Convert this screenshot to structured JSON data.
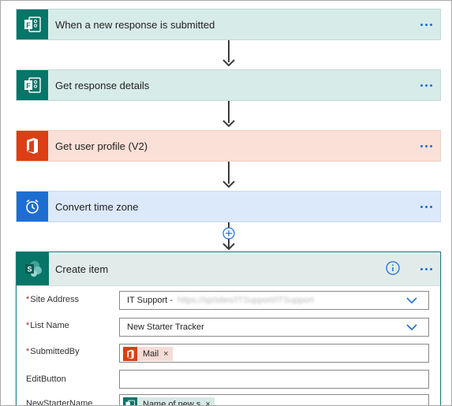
{
  "flow": {
    "steps": [
      {
        "title": "When a new response is submitted",
        "icon": "forms-icon"
      },
      {
        "title": "Get response details",
        "icon": "forms-icon"
      },
      {
        "title": "Get user profile (V2)",
        "icon": "office-icon"
      },
      {
        "title": "Convert time zone",
        "icon": "alarm-clock-icon"
      }
    ]
  },
  "create_item": {
    "title": "Create item",
    "icon": "sharepoint-icon",
    "fields": [
      {
        "label": "Site Address",
        "required": true,
        "value": "IT Support -",
        "value_redacted": "https://sp/sites/ITSupport/ITSupport",
        "type": "dropdown"
      },
      {
        "label": "List Name",
        "required": true,
        "value": "New Starter Tracker",
        "type": "dropdown"
      },
      {
        "label": "SubmittedBy",
        "required": true,
        "token": "Mail",
        "token_icon": "office-icon",
        "type": "token"
      },
      {
        "label": "EditButton",
        "required": false,
        "value": "",
        "type": "text"
      },
      {
        "label": "NewStarterName",
        "required": false,
        "token": "Name of new s",
        "token_icon": "forms-icon",
        "type": "token"
      }
    ]
  },
  "colors": {
    "forms": "#077568",
    "office": "#dc3e15",
    "time": "#1e6ed1",
    "link_blue": "#1e6ed1",
    "required": "#a4262c"
  }
}
